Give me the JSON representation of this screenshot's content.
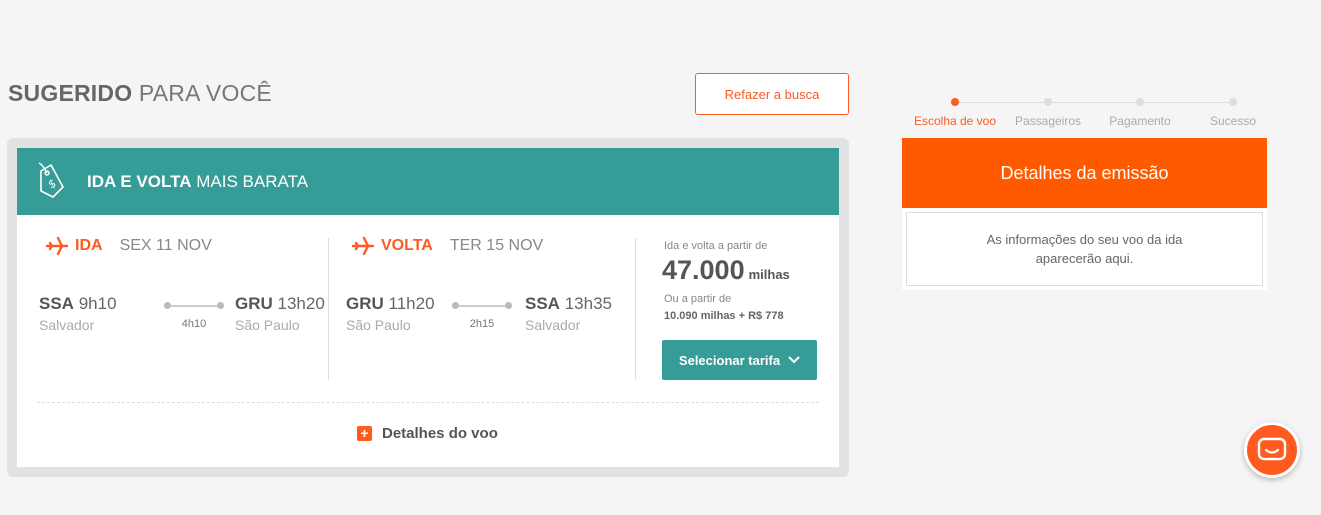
{
  "section_title": {
    "bold": "SUGERIDO",
    "rest": "PARA VOCÊ"
  },
  "redo_search": "Refazer a busca",
  "card": {
    "header_bold": "IDA E VOLTA",
    "header_rest": "MAIS BARATA",
    "ida": {
      "label": "IDA",
      "date": "SEX 11 NOV",
      "origin_code": "SSA",
      "origin_time": "9h10",
      "origin_city": "Salvador",
      "duration": "4h10",
      "dest_code": "GRU",
      "dest_time": "13h20",
      "dest_city": "São Paulo"
    },
    "volta": {
      "label": "VOLTA",
      "date": "TER 15 NOV",
      "origin_code": "GRU",
      "origin_time": "11h20",
      "origin_city": "São Paulo",
      "duration": "2h15",
      "dest_code": "SSA",
      "dest_time": "13h35",
      "dest_city": "Salvador"
    },
    "price": {
      "from_label": "Ida e volta a partir de",
      "miles": "47.000",
      "miles_unit": "milhas",
      "or_label": "Ou a partir de",
      "alt": "10.090 milhas + R$ 778",
      "select_button": "Selecionar tarifa"
    },
    "details_link": "Detalhes do voo"
  },
  "steps": [
    {
      "label": "Escolha de voo",
      "active": true
    },
    {
      "label": "Passageiros",
      "active": false
    },
    {
      "label": "Pagamento",
      "active": false
    },
    {
      "label": "Sucesso",
      "active": false
    }
  ],
  "emission": {
    "title": "Detalhes da emissão",
    "body": "As informações do seu voo da ida aparecerão aqui."
  },
  "colors": {
    "accent": "#ff5a1f",
    "teal": "#359c98"
  },
  "icons": [
    "price-tag-icon",
    "plane-icon",
    "chevron-down-icon",
    "plus-icon",
    "chat-icon"
  ]
}
